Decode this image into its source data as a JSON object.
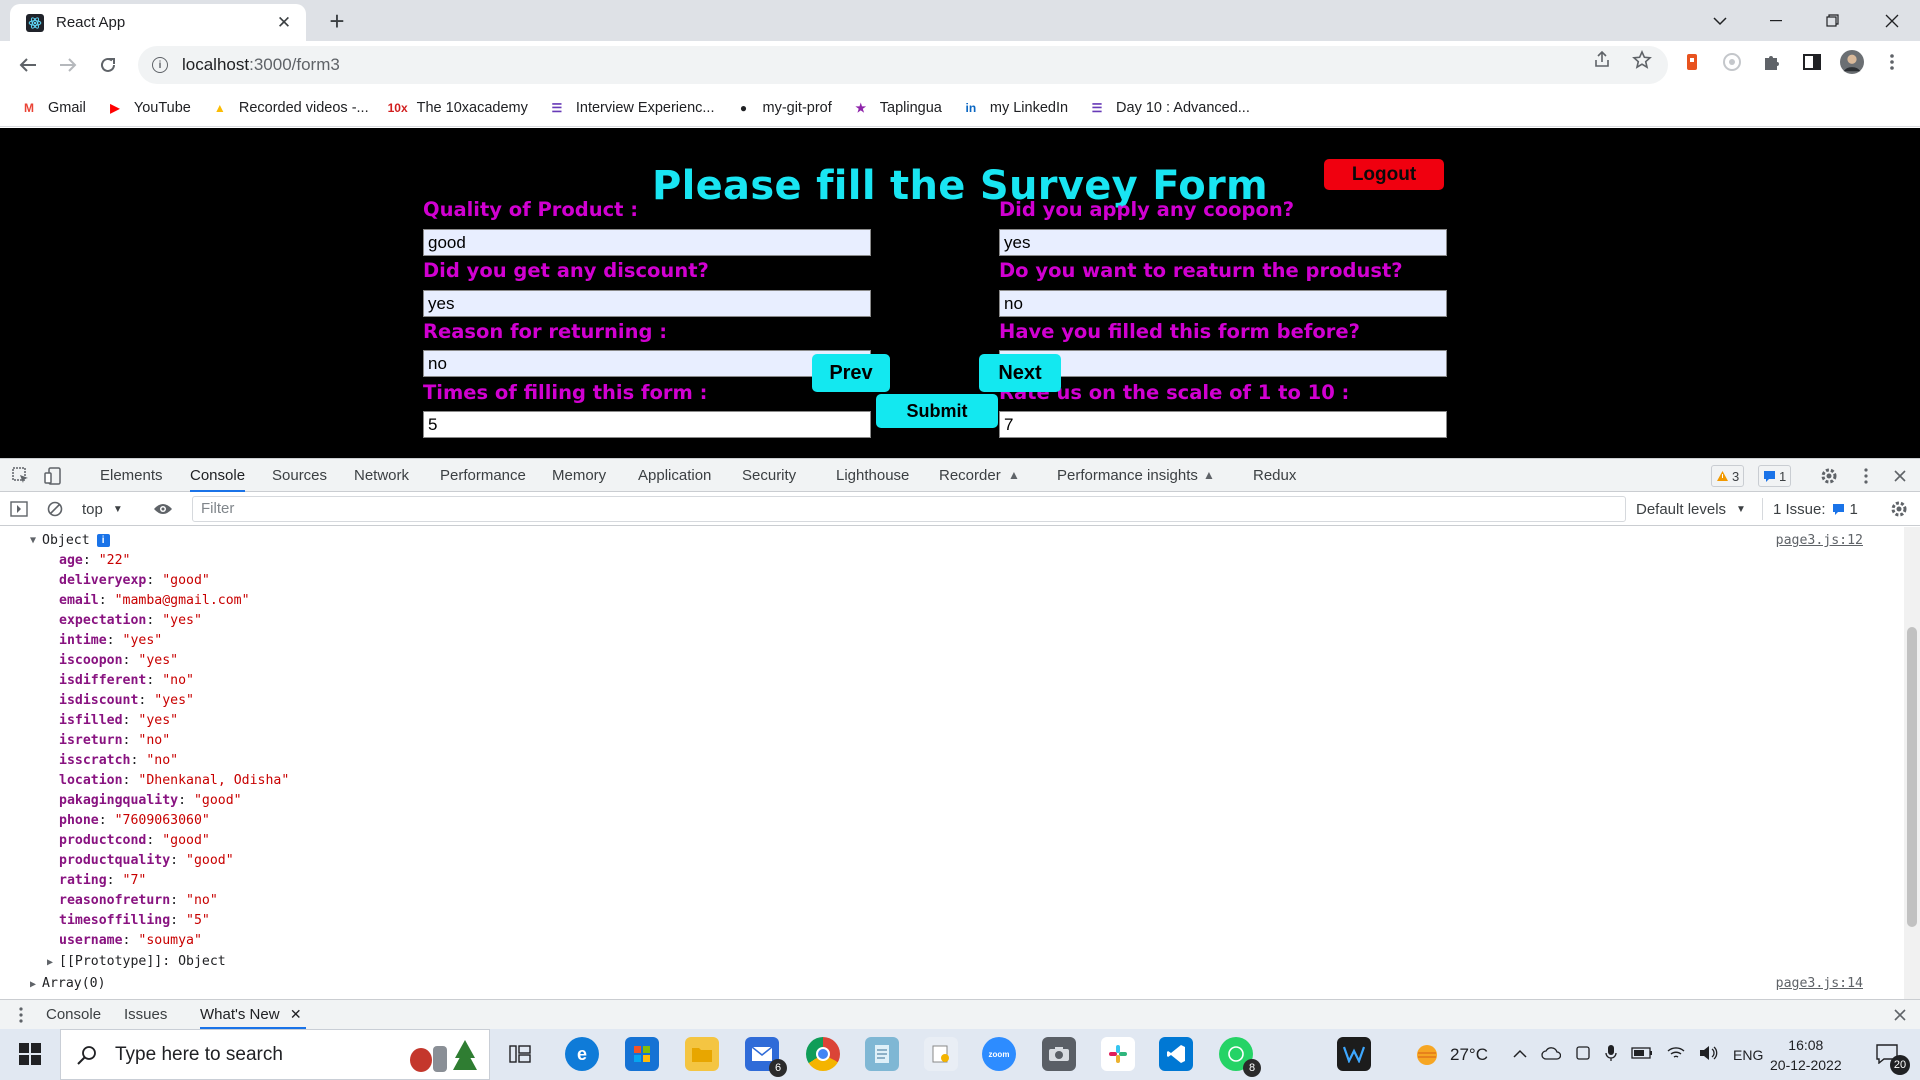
{
  "browser": {
    "tab_title": "React App",
    "tab_close": "✕",
    "new_tab": "+",
    "url_host": "localhost",
    "url_path": ":3000/form3",
    "bookmarks": [
      {
        "label": "Gmail",
        "icon": "gmail-icon",
        "color": "#ea4335",
        "glyph": "M"
      },
      {
        "label": "YouTube",
        "icon": "youtube-icon",
        "color": "#ff0000",
        "glyph": "▶"
      },
      {
        "label": "Recorded videos -...",
        "icon": "google-drive-icon",
        "color": "#fbbc04",
        "glyph": "▲"
      },
      {
        "label": "The 10xacademy",
        "icon": "10x-icon",
        "color": "#d11e1e",
        "glyph": "10x"
      },
      {
        "label": "Interview Experienc...",
        "icon": "forms-icon",
        "color": "#673ab7",
        "glyph": "☰"
      },
      {
        "label": "my-git-prof",
        "icon": "github-icon",
        "color": "#202124",
        "glyph": "●"
      },
      {
        "label": "Taplingua",
        "icon": "star-icon",
        "color": "#8e24aa",
        "glyph": "★"
      },
      {
        "label": "my LinkedIn",
        "icon": "linkedin-icon",
        "color": "#0a66c2",
        "glyph": "in"
      },
      {
        "label": "Day 10 : Advanced...",
        "icon": "forms-icon",
        "color": "#673ab7",
        "glyph": "☰"
      }
    ]
  },
  "survey": {
    "title": "Please fill the Survey Form",
    "logout": "Logout",
    "left_fields": [
      {
        "label": "Quality of Product :",
        "value": "good"
      },
      {
        "label": "Did you get any discount?",
        "value": "yes"
      },
      {
        "label": "Reason for returning :",
        "value": "no"
      },
      {
        "label": "Times of filling this form :",
        "value": "5"
      }
    ],
    "right_fields": [
      {
        "label": "Did you apply any coopon?",
        "value": "yes"
      },
      {
        "label": "Do you want to reaturn the produst?",
        "value": "no"
      },
      {
        "label": "Have you filled this form before?",
        "value": ""
      },
      {
        "label": "Rate us on the scale of 1 to 10 :",
        "value": "7"
      }
    ],
    "prev": "Prev",
    "next": "Next",
    "submit": "Submit"
  },
  "devtools": {
    "tabs": [
      "Elements",
      "Console",
      "Sources",
      "Network",
      "Performance",
      "Memory",
      "Application",
      "Security",
      "Lighthouse",
      "Recorder",
      "Performance insights",
      "Redux"
    ],
    "active_tab": "Console",
    "warnings": "3",
    "messages": "1",
    "context": "top",
    "filter_placeholder": "Filter",
    "levels": "Default levels",
    "issues_label": "1 Issue:",
    "issues_count": "1",
    "object_label": "Object",
    "source_link": "page3.js:12",
    "source_link2": "page3.js:14",
    "properties": [
      {
        "k": "age",
        "v": "\"22\""
      },
      {
        "k": "deliveryexp",
        "v": "\"good\""
      },
      {
        "k": "email",
        "v": "\"mamba@gmail.com\""
      },
      {
        "k": "expectation",
        "v": "\"yes\""
      },
      {
        "k": "intime",
        "v": "\"yes\""
      },
      {
        "k": "iscoopon",
        "v": "\"yes\""
      },
      {
        "k": "isdifferent",
        "v": "\"no\""
      },
      {
        "k": "isdiscount",
        "v": "\"yes\""
      },
      {
        "k": "isfilled",
        "v": "\"yes\""
      },
      {
        "k": "isreturn",
        "v": "\"no\""
      },
      {
        "k": "isscratch",
        "v": "\"no\""
      },
      {
        "k": "location",
        "v": "\"Dhenkanal, Odisha\""
      },
      {
        "k": "pakagingquality",
        "v": "\"good\""
      },
      {
        "k": "phone",
        "v": "\"7609063060\""
      },
      {
        "k": "productcond",
        "v": "\"good\""
      },
      {
        "k": "productquality",
        "v": "\"good\""
      },
      {
        "k": "rating",
        "v": "\"7\""
      },
      {
        "k": "reasonofreturn",
        "v": "\"no\""
      },
      {
        "k": "timesoffilling",
        "v": "\"5\""
      },
      {
        "k": "username",
        "v": "\"soumya\""
      }
    ],
    "prototype_key": "[[Prototype]]",
    "prototype_val": "Object",
    "array_line": "Array(0)",
    "drawer_tabs": [
      "Console",
      "Issues",
      "What's New"
    ]
  },
  "taskbar": {
    "search_placeholder": "Type here to search",
    "temperature": "27°C",
    "language": "ENG",
    "time": "16:08",
    "date": "20-12-2022",
    "notif_count": "20",
    "mail_badge": "6",
    "whatsapp_badge": "8"
  }
}
